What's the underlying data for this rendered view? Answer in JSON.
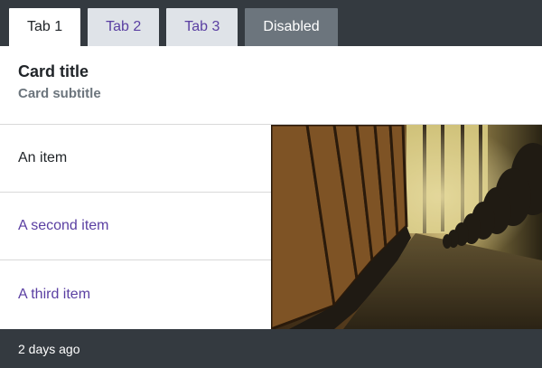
{
  "tabs": [
    {
      "label": "Tab 1",
      "state": "active"
    },
    {
      "label": "Tab 2",
      "state": "link"
    },
    {
      "label": "Tab 3",
      "state": "link"
    },
    {
      "label": "Disabled",
      "state": "disabled"
    }
  ],
  "card": {
    "title": "Card title",
    "subtitle": "Card subtitle"
  },
  "list": {
    "items": [
      {
        "label": "An item"
      },
      {
        "label": "A second item"
      },
      {
        "label": "A third item"
      }
    ]
  },
  "image": {
    "icon": "theater-seats-photo"
  },
  "footer": {
    "text": "2 days ago"
  },
  "colors": {
    "header_bg": "#343a40",
    "link": "#5a3fa2",
    "inactive_tab_bg": "#dfe3e8",
    "disabled_tab_bg": "#6c757d"
  }
}
